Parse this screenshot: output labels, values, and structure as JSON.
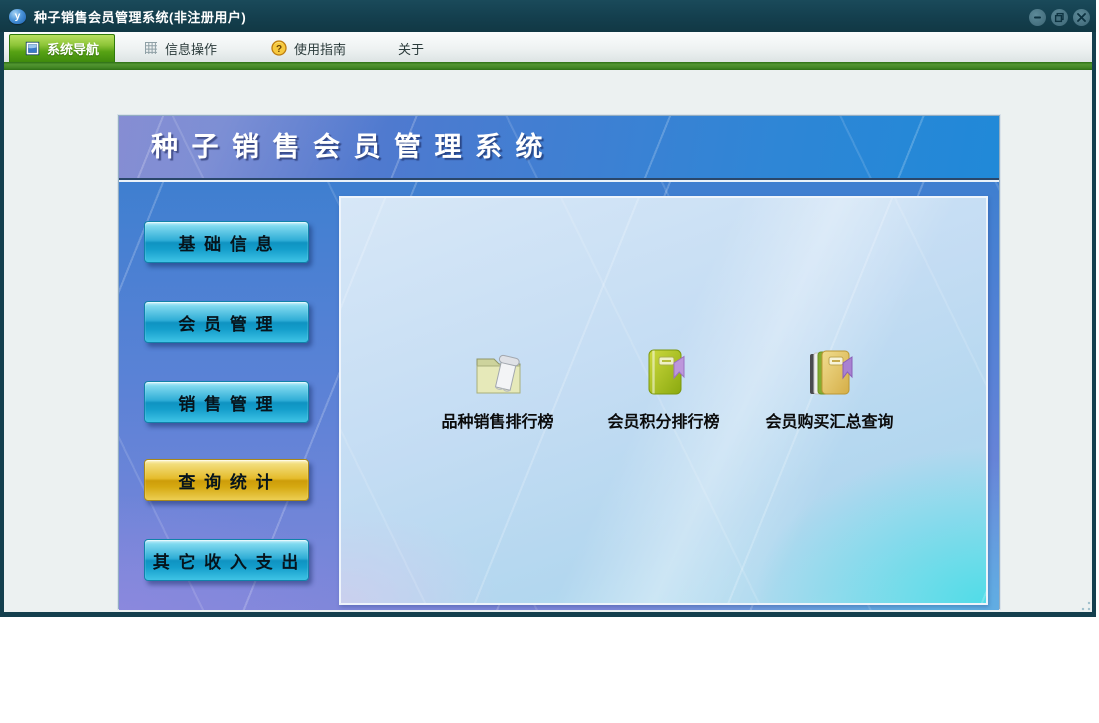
{
  "window": {
    "title": "种子销售会员管理系统(非注册用户)",
    "app_icon_letter": "y"
  },
  "menubar": {
    "items": [
      {
        "label": "系统导航",
        "icon": "blue-panel-icon",
        "active": true
      },
      {
        "label": "信息操作",
        "icon": "grid-icon",
        "active": false
      },
      {
        "label": "使用指南",
        "icon": "help-coin-icon",
        "active": false
      },
      {
        "label": "关于",
        "icon": null,
        "active": false
      }
    ],
    "help_glyph": "?"
  },
  "banner": {
    "title": "种 子 销 售 会 员 管 理 系 统"
  },
  "sidebar": {
    "buttons": [
      {
        "label": "基 础 信 息",
        "variant": "cyan"
      },
      {
        "label": "会 员 管 理",
        "variant": "cyan"
      },
      {
        "label": "销 售 管 理",
        "variant": "cyan"
      },
      {
        "label": "查 询 统 计",
        "variant": "gold"
      },
      {
        "label": "其 它 收 入 支 出",
        "variant": "cyan"
      }
    ]
  },
  "shortcuts": [
    {
      "label": "品种销售排行榜",
      "icon": "folder-scroll-icon"
    },
    {
      "label": "会员积分排行榜",
      "icon": "green-book-icon"
    },
    {
      "label": "会员购买汇总查询",
      "icon": "book-stack-icon"
    }
  ],
  "colors": {
    "titlebar": "#143f4e",
    "accent_green_bar": "#428524",
    "active_tab_green": "#57a214",
    "cyan_button": "#2fadd6",
    "gold_button": "#e5bc2c",
    "banner_left": "#6b74c9",
    "banner_right": "#2089d8",
    "inner_panel_cyan": "#3adce6"
  }
}
